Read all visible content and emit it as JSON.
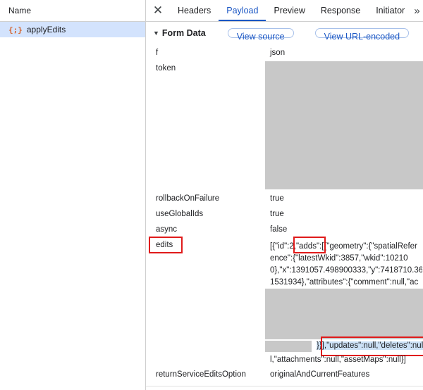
{
  "network_list": {
    "header": "Name",
    "request": {
      "icon": "{;}",
      "name": "applyEdits"
    }
  },
  "tabs": {
    "items": [
      "Headers",
      "Payload",
      "Preview",
      "Response",
      "Initiator"
    ],
    "active": "Payload"
  },
  "form_data": {
    "title": "Form Data",
    "view_source": "View source",
    "view_url_encoded": "View URL-encoded",
    "fields": {
      "f": {
        "key": "f",
        "value": "json"
      },
      "token": {
        "key": "token",
        "value": ""
      },
      "rollback": {
        "key": "rollbackOnFailure",
        "value": "true"
      },
      "global_ids": {
        "key": "useGlobalIds",
        "value": "true"
      },
      "async": {
        "key": "async",
        "value": "false"
      },
      "edits": {
        "key": "edits",
        "line1_a": "[{\"id\":2,",
        "line1_b": "\"adds\"",
        "line1_c": ":[{\"geometry\":{\"spatialRefer",
        "line2": "ence\":{\"latestWkid\":3857,\"wkid\":10210",
        "line3": "0},\"x\":1391057.498900333,\"y\":7418710.36",
        "line4": "1531934},\"attributes\":{\"comment\":null,\"ac",
        "line5_a": "}}]",
        "line5_b": ",\"updates\":null,\"deletes\":null",
        "line6": "l,\"attachments\":null,\"assetMaps\":null}]"
      },
      "return_option": {
        "key": "returnServiceEditsOption",
        "value": "originalAndCurrentFeatures"
      }
    }
  },
  "colors": {
    "accent": "#1a56c4",
    "annotation": "#e01b1b",
    "selected_row": "#d3e3fd",
    "redacted": "#c8c8c8"
  }
}
